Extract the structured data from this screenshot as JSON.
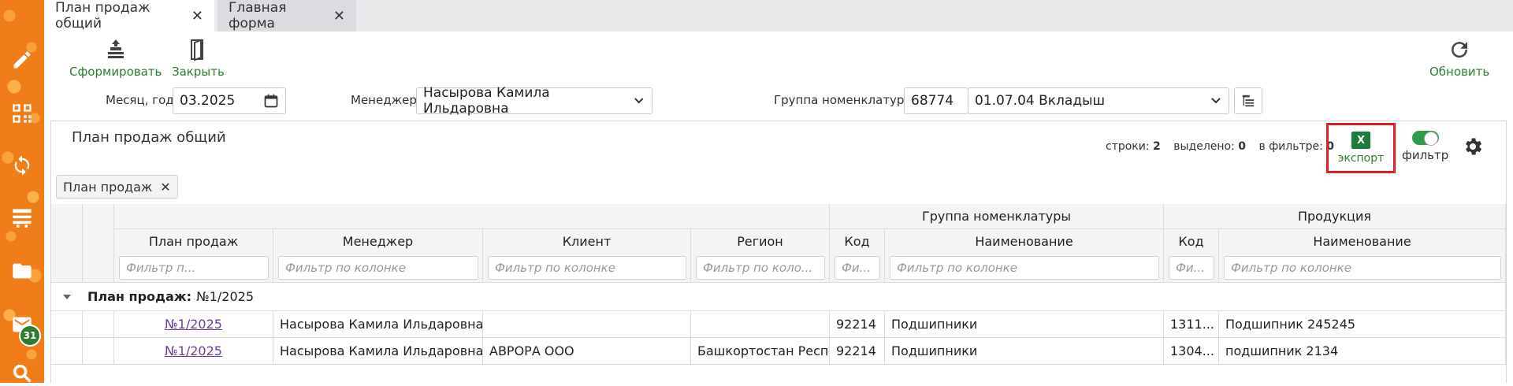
{
  "tabs": [
    {
      "label": "План продаж общий",
      "active": true
    },
    {
      "label": "Главная форма",
      "active": false
    }
  ],
  "tab_close_glyph": "✕",
  "sidebar": {
    "icons": [
      "pencil-icon",
      "qr-code-icon",
      "sync-icon",
      "list-icon",
      "folder-icon",
      "mail-icon",
      "search-icon"
    ],
    "mail_badge": "31"
  },
  "toolbar": {
    "form_label": "Сформировать",
    "close_label": "Закрыть",
    "refresh_label": "Обновить"
  },
  "filters": {
    "month_label": "Месяц, год",
    "month_value": "03.2025",
    "manager_label": "Менеджер",
    "manager_value": "Насырова Камила Ильдаровна",
    "group_label": "Группа номенклатуры",
    "group_code": "68774",
    "group_value": "01.07.04 Вкладыш"
  },
  "panel": {
    "title": "План продаж общий",
    "rows_label": "строки:",
    "rows_value": "2",
    "selected_label": "выделено:",
    "selected_value": "0",
    "in_filter_label": "в фильтре:",
    "in_filter_value": "0",
    "export_label": "экспорт",
    "export_icon_text": "X",
    "filter_label": "фильтр",
    "chip_label": "План продаж",
    "chip_close": "✕"
  },
  "grid": {
    "group_headers": {
      "nomenclature": "Группа номенклатуры",
      "product": "Продукция"
    },
    "columns": {
      "plan": "План продаж",
      "manager": "Менеджер",
      "client": "Клиент",
      "region": "Регион",
      "nom_code": "Код",
      "nom_name": "Наименование",
      "prod_code": "Код",
      "prod_name": "Наименование"
    },
    "filter_placeholders": {
      "plan": "Фильтр п...",
      "manager": "Фильтр по колонке",
      "client": "Фильтр по колонке",
      "region": "Фильтр по коло...",
      "nom_code": "Фи...",
      "nom_name": "Фильтр по колонке",
      "prod_code": "Фи...",
      "prod_name": "Фильтр по колонке"
    },
    "group_row": {
      "label": "План продаж:",
      "value": "№1/2025"
    },
    "rows": [
      {
        "plan": "№1/2025",
        "manager": "Насырова Камила Ильдаровна",
        "client": "",
        "region": "",
        "nom_code": "92214",
        "nom_name": "Подшипники",
        "prod_code": "1311...",
        "prod_name": "Подшипник 245245"
      },
      {
        "plan": "№1/2025",
        "manager": "Насырова Камила Ильдаровна",
        "client": "АВРОРА ООО",
        "region": "Башкортостан Респ",
        "nom_code": "92214",
        "nom_name": "Подшипники",
        "prod_code": "1304...",
        "prod_name": "подшипник 2134"
      }
    ]
  }
}
